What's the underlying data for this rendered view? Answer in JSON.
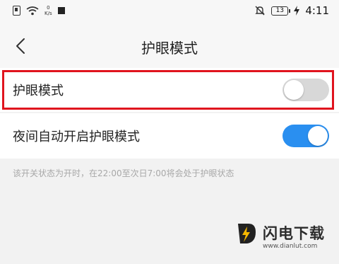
{
  "status_bar": {
    "speed_value": "0",
    "speed_unit": "K/s",
    "battery_level": "13",
    "time": "4:11"
  },
  "header": {
    "title": "护眼模式"
  },
  "settings": {
    "eye_mode": {
      "label": "护眼模式",
      "enabled": false
    },
    "night_auto": {
      "label": "夜间自动开启护眼模式",
      "enabled": true
    },
    "hint": "该开关状态为开时，在22:00至次日7:00将会处于护眼状态"
  },
  "watermark": {
    "brand": "闪电下载",
    "url": "www.dianlut.com"
  },
  "colors": {
    "toggle_on": "#2a8ff0",
    "toggle_off": "#d8d8d8",
    "highlight": "#e0141e"
  }
}
